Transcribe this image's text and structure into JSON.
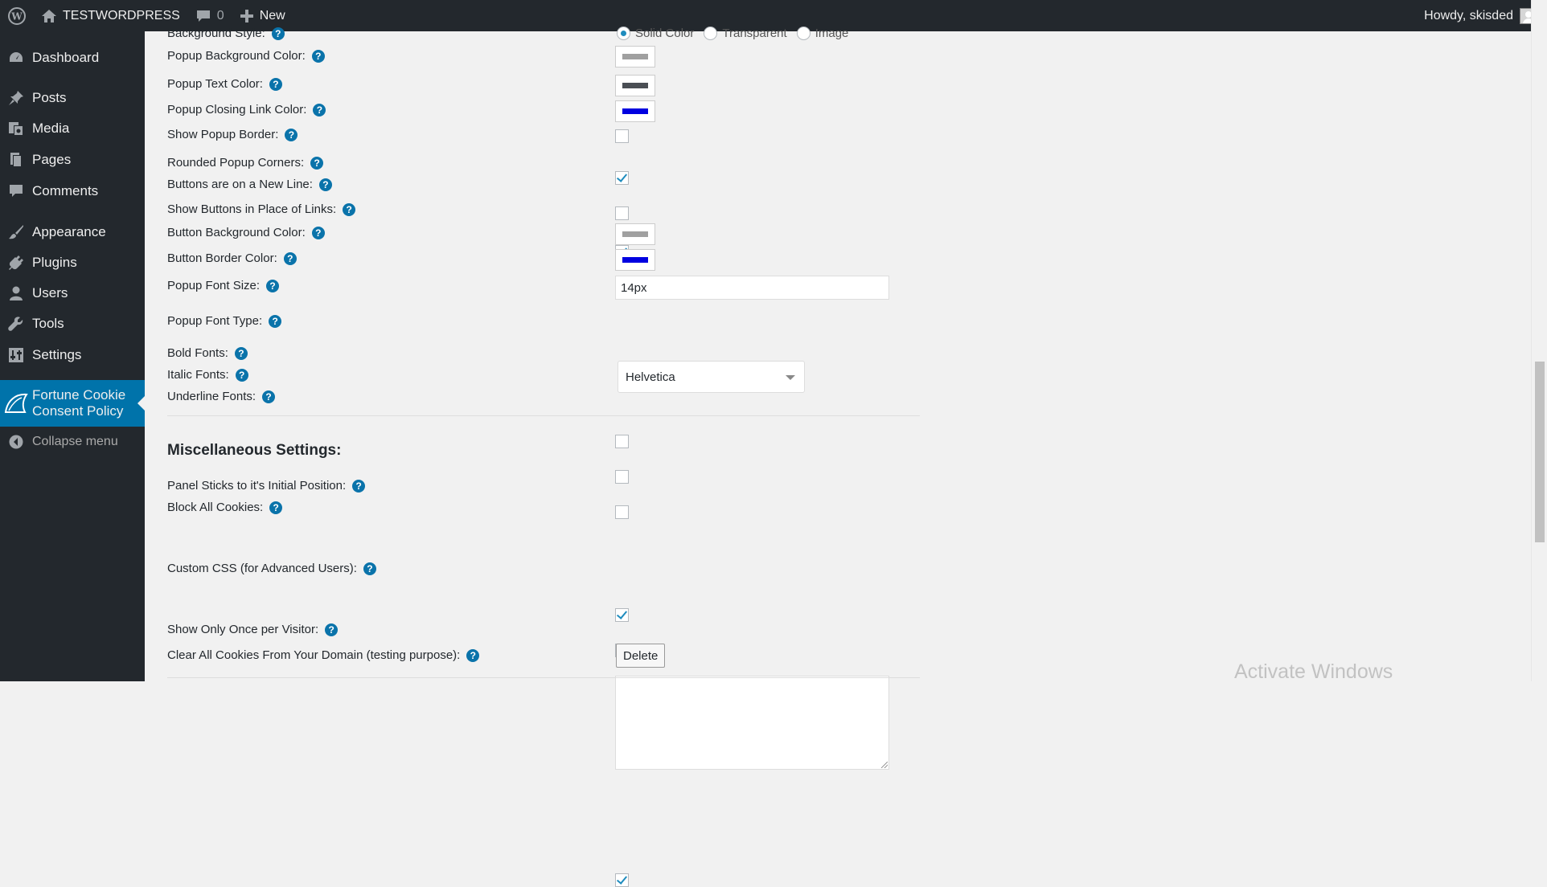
{
  "admin_bar": {
    "site_name": "TESTWORDPRESS",
    "comments_count": "0",
    "new_label": "New",
    "greeting": "Howdy, skisded"
  },
  "sidebar": {
    "items": [
      {
        "label": "Dashboard",
        "icon": "dashboard-icon"
      },
      {
        "label": "Posts",
        "icon": "pin-icon"
      },
      {
        "label": "Media",
        "icon": "media-icon"
      },
      {
        "label": "Pages",
        "icon": "pages-icon"
      },
      {
        "label": "Comments",
        "icon": "comment-icon"
      },
      {
        "label": "Appearance",
        "icon": "brush-icon"
      },
      {
        "label": "Plugins",
        "icon": "plug-icon"
      },
      {
        "label": "Users",
        "icon": "user-icon"
      },
      {
        "label": "Tools",
        "icon": "wrench-icon"
      },
      {
        "label": "Settings",
        "icon": "sliders-icon"
      }
    ],
    "active_item": {
      "line1": "Fortune Cookie",
      "line2": "Consent Policy"
    },
    "collapse_label": "Collapse menu"
  },
  "settings": {
    "background_style": {
      "label": "Background Style:",
      "options": [
        "Solid Color",
        "Transparent",
        "Image"
      ],
      "selected": "Solid Color"
    },
    "popup_bg_color": {
      "label": "Popup Background Color:",
      "color": "#a0a0a0"
    },
    "popup_text_color": {
      "label": "Popup Text Color:",
      "color": "#4a4e54"
    },
    "popup_link_color": {
      "label": "Popup Closing Link Color:",
      "color": "#0000e0"
    },
    "show_popup_border": {
      "label": "Show Popup Border:",
      "checked": false
    },
    "rounded_corners": {
      "label": "Rounded Popup Corners:",
      "checked": true
    },
    "buttons_new_line": {
      "label": "Buttons are on a New Line:",
      "checked": false
    },
    "buttons_in_place": {
      "label": "Show Buttons in Place of Links:",
      "checked": true
    },
    "button_bg_color": {
      "label": "Button Background Color:",
      "color": "#a0a0a0"
    },
    "button_border_color": {
      "label": "Button Border Color:",
      "color": "#0000e0"
    },
    "font_size": {
      "label": "Popup Font Size:",
      "value": "14px"
    },
    "font_type": {
      "label": "Popup Font Type:",
      "value": "Helvetica"
    },
    "bold_fonts": {
      "label": "Bold Fonts:",
      "checked": false
    },
    "italic_fonts": {
      "label": "Italic Fonts:",
      "checked": false
    },
    "underline_fonts": {
      "label": "Underline Fonts:",
      "checked": false
    }
  },
  "misc": {
    "title": "Miscellaneous Settings:",
    "panel_sticks": {
      "label": "Panel Sticks to it's Initial Position:",
      "checked": true
    },
    "block_cookies": {
      "label": "Block All Cookies:",
      "checked": false
    },
    "custom_css": {
      "label": "Custom CSS (for Advanced Users):",
      "value": ""
    },
    "show_once": {
      "label": "Show Only Once per Visitor:",
      "checked": true
    },
    "clear_cookies": {
      "label": "Clear All Cookies From Your Domain (testing purpose):",
      "button": "Delete"
    }
  },
  "help_glyph": "?",
  "watermark": "Activate Windows"
}
